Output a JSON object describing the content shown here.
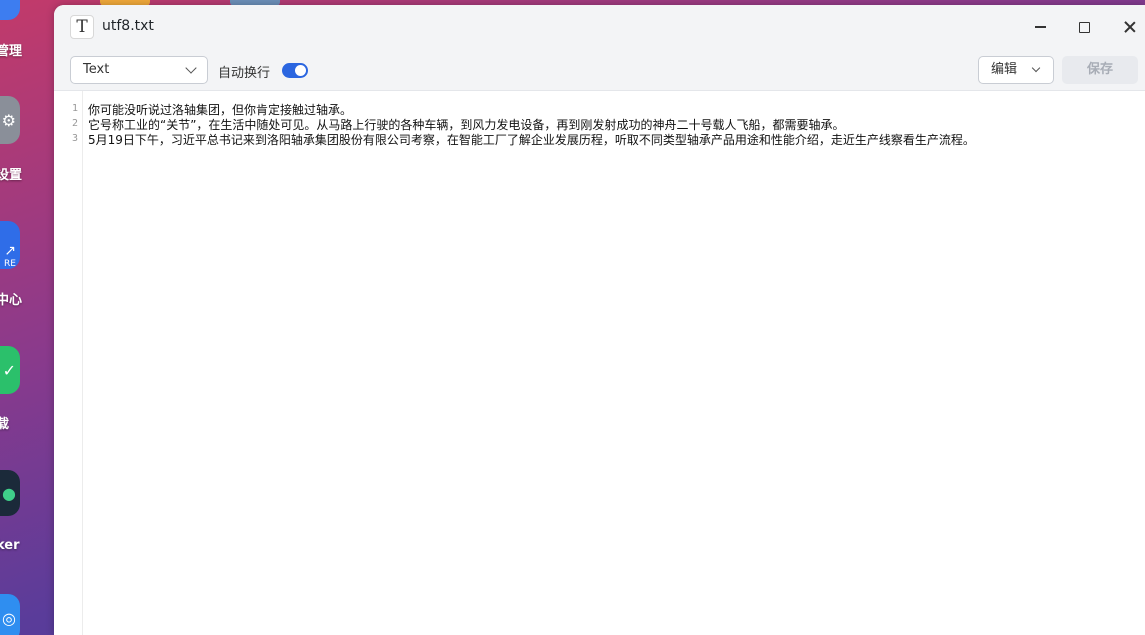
{
  "desktop": {
    "apps": [
      {
        "label": "管理",
        "icon": "manager-icon",
        "color": "#3d7df0"
      },
      {
        "label": "设置",
        "icon": "gear-icon",
        "color": "#8a8f99"
      },
      {
        "label": "中心",
        "icon": "store-icon",
        "color": "#2f6de8",
        "badge": "RE"
      },
      {
        "label": "载",
        "icon": "download-icon",
        "color": "#2bc06b"
      },
      {
        "label": "ker",
        "icon": "docker-icon",
        "color": "#1b2a3a"
      },
      {
        "label": "",
        "icon": "support-icon",
        "color": "#2f8ef0"
      }
    ]
  },
  "window": {
    "title": "utf8.txt",
    "app_icon_glyph": "T"
  },
  "toolbar": {
    "mode_select_value": "Text",
    "wrap_label": "自动换行",
    "wrap_enabled": true,
    "edit_label": "编辑",
    "save_label": "保存"
  },
  "editor": {
    "lines": [
      {
        "no": "1",
        "text": "你可能没听说过洛轴集团，但你肯定接触过轴承。"
      },
      {
        "no": "2",
        "text": "它号称工业的“关节”，在生活中随处可见。从马路上行驶的各种车辆，到风力发电设备，再到刚发射成功的神舟二十号载人飞船，都需要轴承。"
      },
      {
        "no": "3",
        "text": "5月19日下午，习近平总书记来到洛阳轴承集团股份有限公司考察，在智能工厂了解企业发展历程，听取不同类型轴承产品用途和性能介绍，走近生产线察看生产流程。"
      }
    ]
  },
  "colors": {
    "accent": "#2b66e0",
    "toolbar_bg": "#f3f4f6"
  }
}
